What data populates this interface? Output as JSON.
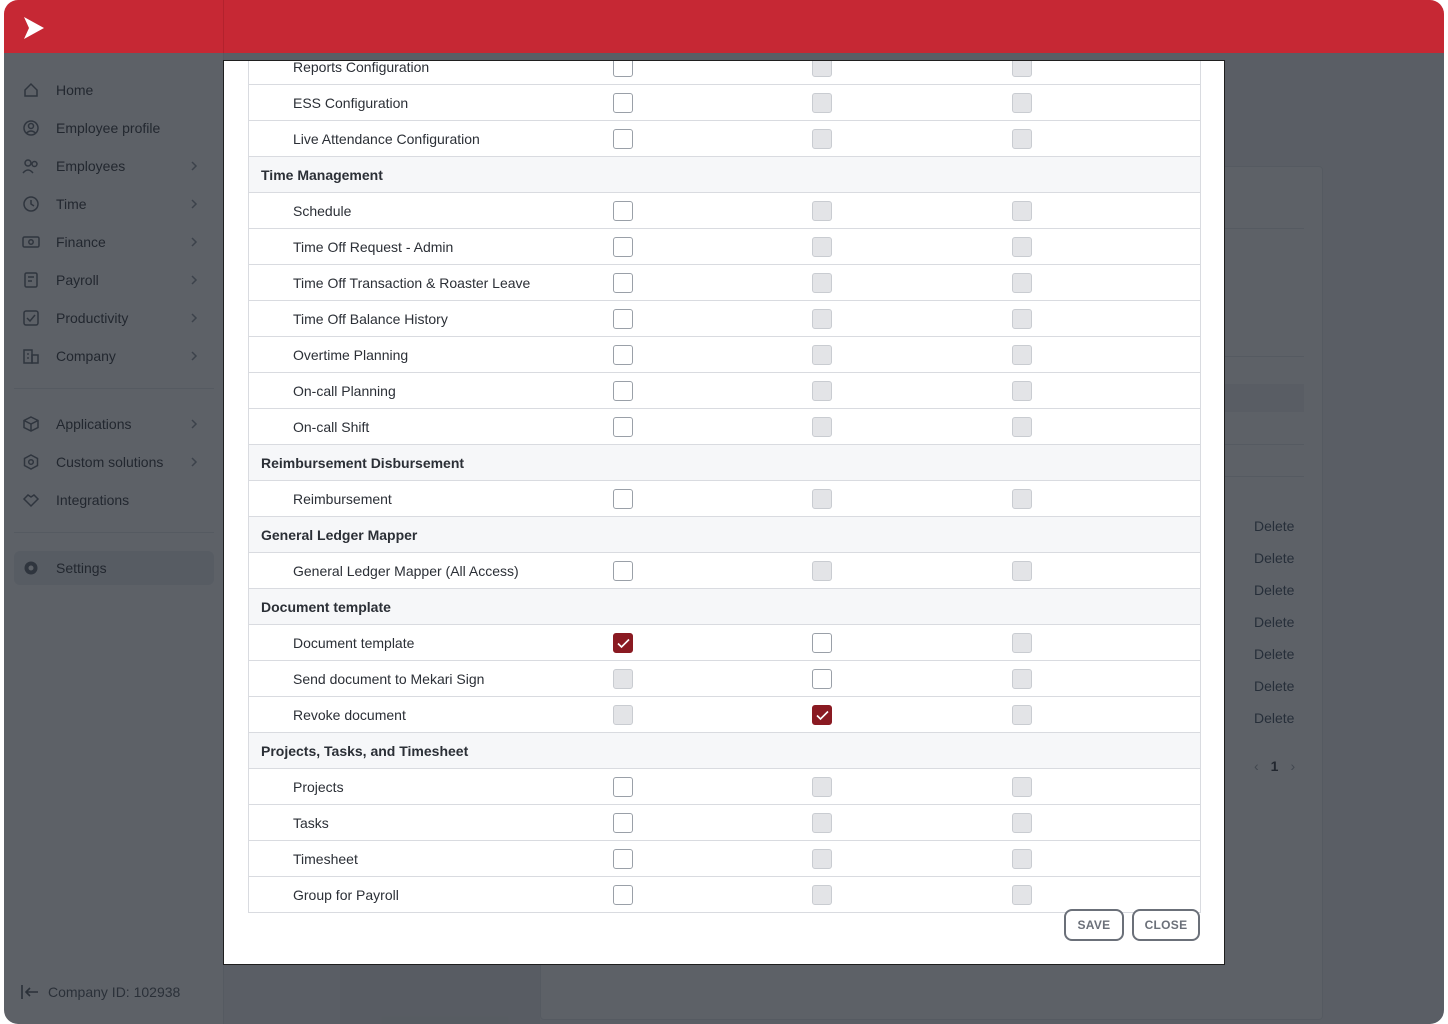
{
  "app": {
    "brand_color": "#c62834",
    "company_id": "Company ID: 102938"
  },
  "sidebar": {
    "items": [
      {
        "label": "Home",
        "icon": "home-icon",
        "chevron": false
      },
      {
        "label": "Employee profile",
        "icon": "user-circle-icon",
        "chevron": false
      },
      {
        "label": "Employees",
        "icon": "users-icon",
        "chevron": true
      },
      {
        "label": "Time",
        "icon": "clock-icon",
        "chevron": true
      },
      {
        "label": "Finance",
        "icon": "money-icon",
        "chevron": true
      },
      {
        "label": "Payroll",
        "icon": "payroll-icon",
        "chevron": true
      },
      {
        "label": "Productivity",
        "icon": "checklist-icon",
        "chevron": true
      },
      {
        "label": "Company",
        "icon": "building-icon",
        "chevron": true
      },
      {
        "label": "Applications",
        "icon": "cube-icon",
        "chevron": true
      },
      {
        "label": "Custom solutions",
        "icon": "hexagon-icon",
        "chevron": true
      },
      {
        "label": "Integrations",
        "icon": "handshake-icon",
        "chevron": false
      },
      {
        "label": "Settings",
        "icon": "gear-icon",
        "chevron": false,
        "active": true
      }
    ]
  },
  "background": {
    "delete_label": "Delete",
    "page_number": "1"
  },
  "modal": {
    "rows": [
      {
        "type": "item",
        "label": "Reports Configuration",
        "checks": [
          "empty",
          "disabled",
          "disabled"
        ]
      },
      {
        "type": "item",
        "label": "ESS Configuration",
        "checks": [
          "empty",
          "disabled",
          "disabled"
        ]
      },
      {
        "type": "item",
        "label": "Live Attendance Configuration",
        "checks": [
          "empty",
          "disabled",
          "disabled"
        ]
      },
      {
        "type": "section",
        "label": "Time Management"
      },
      {
        "type": "item",
        "label": "Schedule",
        "checks": [
          "empty",
          "disabled",
          "disabled"
        ]
      },
      {
        "type": "item",
        "label": "Time Off Request - Admin",
        "checks": [
          "empty",
          "disabled",
          "disabled"
        ]
      },
      {
        "type": "item",
        "label": "Time Off Transaction & Roaster Leave",
        "checks": [
          "empty",
          "disabled",
          "disabled"
        ]
      },
      {
        "type": "item",
        "label": "Time Off Balance History",
        "checks": [
          "empty",
          "disabled",
          "disabled"
        ]
      },
      {
        "type": "item",
        "label": "Overtime Planning",
        "checks": [
          "empty",
          "disabled",
          "disabled"
        ]
      },
      {
        "type": "item",
        "label": "On-call Planning",
        "checks": [
          "empty",
          "disabled",
          "disabled"
        ]
      },
      {
        "type": "item",
        "label": "On-call Shift",
        "checks": [
          "empty",
          "disabled",
          "disabled"
        ]
      },
      {
        "type": "section",
        "label": "Reimbursement Disbursement"
      },
      {
        "type": "item",
        "label": "Reimbursement",
        "checks": [
          "empty",
          "disabled",
          "disabled"
        ]
      },
      {
        "type": "section",
        "label": "General Ledger Mapper"
      },
      {
        "type": "item",
        "label": "General Ledger Mapper (All Access)",
        "checks": [
          "empty",
          "disabled",
          "disabled"
        ]
      },
      {
        "type": "section",
        "label": "Document template"
      },
      {
        "type": "item",
        "label": "Document template",
        "checks": [
          "checked",
          "empty",
          "disabled"
        ]
      },
      {
        "type": "item",
        "label": "Send document to Mekari Sign",
        "checks": [
          "disabled",
          "empty",
          "disabled"
        ]
      },
      {
        "type": "item",
        "label": "Revoke document",
        "checks": [
          "disabled",
          "checked",
          "disabled"
        ]
      },
      {
        "type": "section",
        "label": "Projects, Tasks, and Timesheet"
      },
      {
        "type": "item",
        "label": "Projects",
        "checks": [
          "empty",
          "disabled",
          "disabled"
        ]
      },
      {
        "type": "item",
        "label": "Tasks",
        "checks": [
          "empty",
          "disabled",
          "disabled"
        ]
      },
      {
        "type": "item",
        "label": "Timesheet",
        "checks": [
          "empty",
          "disabled",
          "disabled"
        ]
      },
      {
        "type": "item",
        "label": "Group for Payroll",
        "checks": [
          "empty",
          "disabled",
          "disabled"
        ]
      }
    ],
    "save_label": "SAVE",
    "close_label": "CLOSE"
  }
}
